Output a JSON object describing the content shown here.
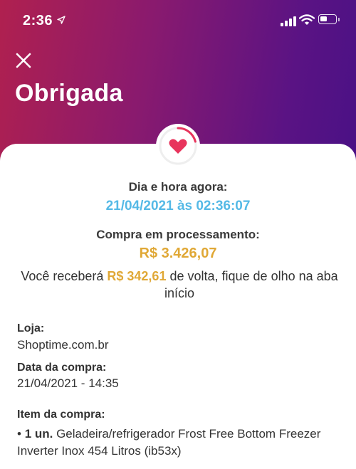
{
  "status_bar": {
    "time": "2:36",
    "icons": [
      "location-arrow-icon",
      "cellular-signal-icon",
      "wifi-icon",
      "battery-icon"
    ]
  },
  "header": {
    "close_icon": "close-icon",
    "title": "Obrigada"
  },
  "badge": {
    "icon": "heart-icon",
    "colors": {
      "heart": "#e8345c",
      "ring_track": "#eeeeee",
      "ring_progress": "#e8345c"
    }
  },
  "datetime": {
    "label": "Dia e hora agora:",
    "value": "21/04/2021 às 02:36:07"
  },
  "purchase": {
    "label": "Compra em processamento:",
    "amount": "R$ 3.426,07"
  },
  "cashback": {
    "prefix": "Você receberá ",
    "amount": "R$ 342,61",
    "suffix": " de volta, fique de olho na aba início"
  },
  "details": {
    "store_label": "Loja:",
    "store_value": "Shoptime.com.br",
    "date_label": "Data da compra:",
    "date_value": "21/04/2021 - 14:35",
    "item_label": "Item da compra:",
    "item_bullet": "• ",
    "item_qty": "1 un.",
    "item_desc": " Geladeira/refrigerador Frost Free Bottom Freezer Inverter Inox 454 Litros (ib53x)"
  },
  "colors": {
    "gradient_start": "#b0204f",
    "gradient_end": "#3f0f86",
    "datetime_blue": "#55b9e6",
    "amount_gold": "#e0a836",
    "accent_pink": "#e8345c"
  }
}
